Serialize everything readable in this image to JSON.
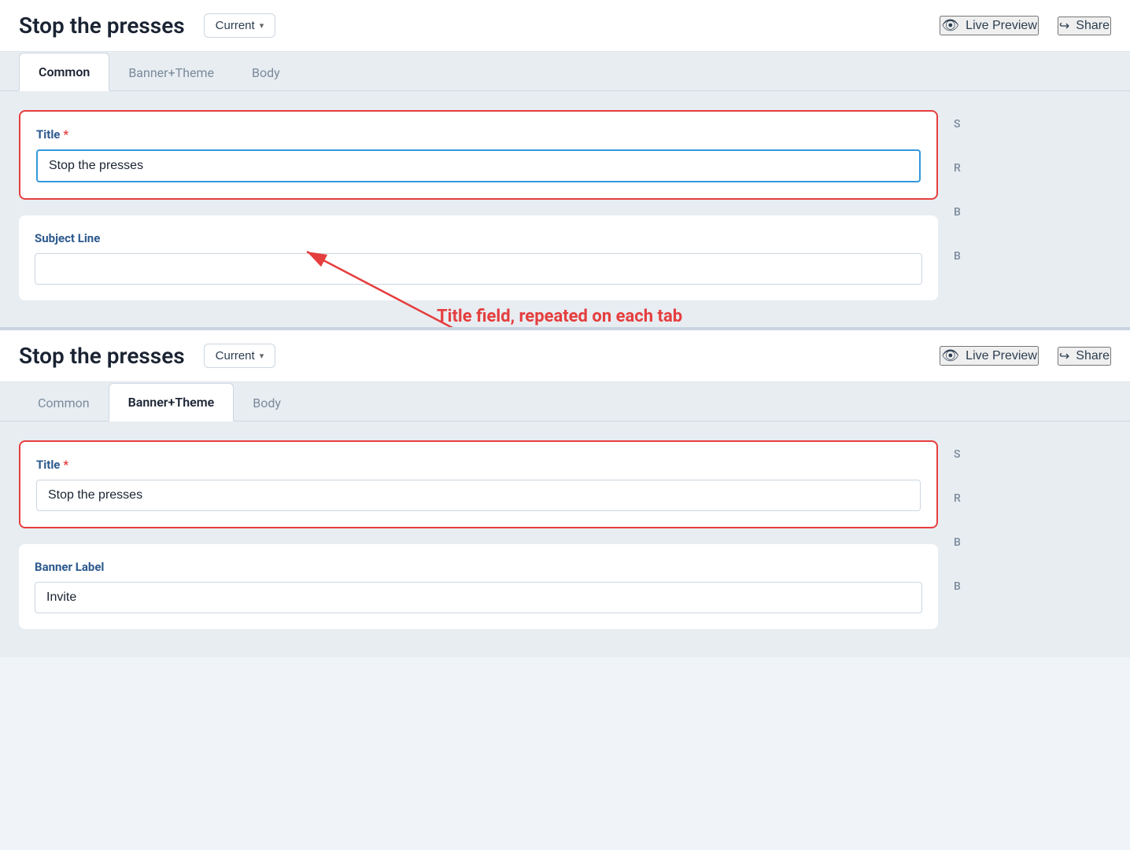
{
  "panel1": {
    "title": "Stop the presses",
    "current_label": "Current",
    "live_preview_label": "Live Preview",
    "share_label": "Share",
    "tabs": [
      {
        "id": "common",
        "label": "Common",
        "active": true
      },
      {
        "id": "banner_theme",
        "label": "Banner+Theme",
        "active": false
      },
      {
        "id": "body",
        "label": "Body",
        "active": false
      }
    ],
    "title_field": {
      "label": "Title",
      "value": "Stop the presses",
      "placeholder": ""
    },
    "subject_line_field": {
      "label": "Subject Line",
      "value": "",
      "placeholder": ""
    }
  },
  "panel2": {
    "title": "Stop the presses",
    "current_label": "Current",
    "live_preview_label": "Live Preview",
    "share_label": "Share",
    "tabs": [
      {
        "id": "common",
        "label": "Common",
        "active": false
      },
      {
        "id": "banner_theme",
        "label": "Banner+Theme",
        "active": true
      },
      {
        "id": "body",
        "label": "Body",
        "active": false
      }
    ],
    "title_field": {
      "label": "Title",
      "value": "Stop the presses",
      "placeholder": ""
    },
    "banner_label_field": {
      "label": "Banner Label",
      "value": "Invite",
      "placeholder": ""
    }
  },
  "annotation": {
    "text": "Title field, repeated on each tab"
  },
  "right_sidebar": {
    "items": [
      "S",
      "R",
      "B",
      "B"
    ]
  }
}
